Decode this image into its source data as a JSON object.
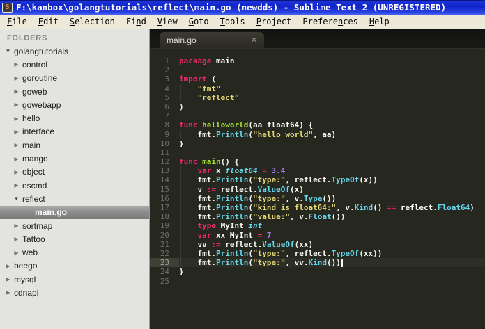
{
  "title_bar": {
    "title": "F:\\kanbox\\golangtutorials\\reflect\\main.go (newdds) - Sublime Text 2 (UNREGISTERED)",
    "icon_glyph": "S"
  },
  "menu": {
    "items": [
      {
        "label": "File",
        "accel": 0
      },
      {
        "label": "Edit",
        "accel": 0
      },
      {
        "label": "Selection",
        "accel": 0
      },
      {
        "label": "Find",
        "accel": 2
      },
      {
        "label": "View",
        "accel": 0
      },
      {
        "label": "Goto",
        "accel": 0
      },
      {
        "label": "Tools",
        "accel": 0
      },
      {
        "label": "Project",
        "accel": 0
      },
      {
        "label": "Preferences",
        "accel": 7
      },
      {
        "label": "Help",
        "accel": 0
      }
    ]
  },
  "sidebar": {
    "header": "FOLDERS",
    "items": [
      {
        "label": "golangtutorials",
        "indent": 0,
        "state": "open"
      },
      {
        "label": "control",
        "indent": 1,
        "state": "closed"
      },
      {
        "label": "goroutine",
        "indent": 1,
        "state": "closed"
      },
      {
        "label": "goweb",
        "indent": 1,
        "state": "closed"
      },
      {
        "label": "gowebapp",
        "indent": 1,
        "state": "closed"
      },
      {
        "label": "hello",
        "indent": 1,
        "state": "closed"
      },
      {
        "label": "interface",
        "indent": 1,
        "state": "closed"
      },
      {
        "label": "main",
        "indent": 1,
        "state": "closed"
      },
      {
        "label": "mango",
        "indent": 1,
        "state": "closed"
      },
      {
        "label": "object",
        "indent": 1,
        "state": "closed"
      },
      {
        "label": "oscmd",
        "indent": 1,
        "state": "closed"
      },
      {
        "label": "reflect",
        "indent": 1,
        "state": "open"
      },
      {
        "label": "main.go",
        "indent": 2,
        "state": "file",
        "selected": true
      },
      {
        "label": "sortmap",
        "indent": 1,
        "state": "closed"
      },
      {
        "label": "Tattoo",
        "indent": 1,
        "state": "closed"
      },
      {
        "label": "web",
        "indent": 1,
        "state": "closed"
      },
      {
        "label": "beego",
        "indent": 0,
        "state": "closed"
      },
      {
        "label": "mysql",
        "indent": 0,
        "state": "closed"
      },
      {
        "label": "cdnapi",
        "indent": 0,
        "state": "closed"
      }
    ]
  },
  "tab": {
    "label": "main.go",
    "close_glyph": "✕"
  },
  "editor": {
    "current_line": 23,
    "palette": {
      "kw": "#F92672",
      "str": "#E6DB74",
      "fn": "#A6E22E",
      "type": "#66D9EF",
      "call": "#66D9EF",
      "num": "#AE81FF",
      "fg": "#F8F8F2",
      "bg": "#26271F",
      "gutter": "#6E6F66",
      "sel_line": "#3E3F35"
    },
    "lines": [
      {
        "num": 1,
        "segs": [
          [
            "package",
            "k"
          ],
          [
            " main",
            "d"
          ]
        ]
      },
      {
        "num": 2,
        "segs": []
      },
      {
        "num": 3,
        "segs": [
          [
            "import",
            "k"
          ],
          [
            " (",
            "d"
          ]
        ]
      },
      {
        "num": 4,
        "g": true,
        "segs": [
          [
            "    ",
            "d"
          ],
          [
            "\"fmt\"",
            "s"
          ]
        ]
      },
      {
        "num": 5,
        "g": true,
        "segs": [
          [
            "    ",
            "d"
          ],
          [
            "\"reflect\"",
            "s"
          ]
        ]
      },
      {
        "num": 6,
        "segs": [
          [
            ")",
            "d"
          ]
        ]
      },
      {
        "num": 7,
        "segs": []
      },
      {
        "num": 8,
        "segs": [
          [
            "func",
            "k"
          ],
          [
            " ",
            "d"
          ],
          [
            "helloworld",
            "f"
          ],
          [
            "(aa float64) {",
            "d"
          ]
        ]
      },
      {
        "num": 9,
        "g": true,
        "segs": [
          [
            "    fmt.",
            "d"
          ],
          [
            "Println",
            "c"
          ],
          [
            "(",
            "d"
          ],
          [
            "\"hello world\"",
            "s"
          ],
          [
            ", aa)",
            "d"
          ]
        ]
      },
      {
        "num": 10,
        "segs": [
          [
            "}",
            "d"
          ]
        ]
      },
      {
        "num": 11,
        "segs": []
      },
      {
        "num": 12,
        "segs": [
          [
            "func",
            "k"
          ],
          [
            " ",
            "d"
          ],
          [
            "main",
            "f"
          ],
          [
            "() {",
            "d"
          ]
        ]
      },
      {
        "num": 13,
        "g": true,
        "segs": [
          [
            "    ",
            "d"
          ],
          [
            "var",
            "k"
          ],
          [
            " x ",
            "d"
          ],
          [
            "float64",
            "t"
          ],
          [
            " ",
            "d"
          ],
          [
            "=",
            "k"
          ],
          [
            " ",
            "d"
          ],
          [
            "3.4",
            "n"
          ]
        ]
      },
      {
        "num": 14,
        "g": true,
        "segs": [
          [
            "    fmt.",
            "d"
          ],
          [
            "Println",
            "c"
          ],
          [
            "(",
            "d"
          ],
          [
            "\"type:\"",
            "s"
          ],
          [
            ", reflect.",
            "d"
          ],
          [
            "TypeOf",
            "c"
          ],
          [
            "(x))",
            "d"
          ]
        ]
      },
      {
        "num": 15,
        "g": true,
        "segs": [
          [
            "    v ",
            "d"
          ],
          [
            ":=",
            "k"
          ],
          [
            " reflect.",
            "d"
          ],
          [
            "ValueOf",
            "c"
          ],
          [
            "(x)",
            "d"
          ]
        ]
      },
      {
        "num": 16,
        "g": true,
        "segs": [
          [
            "    fmt.",
            "d"
          ],
          [
            "Println",
            "c"
          ],
          [
            "(",
            "d"
          ],
          [
            "\"type:\"",
            "s"
          ],
          [
            ", v.",
            "d"
          ],
          [
            "Type",
            "c"
          ],
          [
            "())",
            "d"
          ]
        ]
      },
      {
        "num": 17,
        "g": true,
        "segs": [
          [
            "    fmt.",
            "d"
          ],
          [
            "Println",
            "c"
          ],
          [
            "(",
            "d"
          ],
          [
            "\"kind is float64:\"",
            "s"
          ],
          [
            ", v.",
            "d"
          ],
          [
            "Kind",
            "c"
          ],
          [
            "() ",
            "d"
          ],
          [
            "==",
            "k"
          ],
          [
            " reflect.",
            "d"
          ],
          [
            "Float64",
            "c"
          ],
          [
            ")",
            "d"
          ]
        ]
      },
      {
        "num": 18,
        "g": true,
        "segs": [
          [
            "    fmt.",
            "d"
          ],
          [
            "Println",
            "c"
          ],
          [
            "(",
            "d"
          ],
          [
            "\"value:\"",
            "s"
          ],
          [
            ", v.",
            "d"
          ],
          [
            "Float",
            "c"
          ],
          [
            "())",
            "d"
          ]
        ]
      },
      {
        "num": 19,
        "g": true,
        "segs": [
          [
            "    ",
            "d"
          ],
          [
            "type",
            "k"
          ],
          [
            " MyInt ",
            "d"
          ],
          [
            "int",
            "t"
          ]
        ]
      },
      {
        "num": 20,
        "g": true,
        "segs": [
          [
            "    ",
            "d"
          ],
          [
            "var",
            "k"
          ],
          [
            " xx MyInt ",
            "d"
          ],
          [
            "=",
            "k"
          ],
          [
            " ",
            "d"
          ],
          [
            "7",
            "n"
          ]
        ]
      },
      {
        "num": 21,
        "g": true,
        "segs": [
          [
            "    vv ",
            "d"
          ],
          [
            ":=",
            "k"
          ],
          [
            " reflect.",
            "d"
          ],
          [
            "ValueOf",
            "c"
          ],
          [
            "(xx)",
            "d"
          ]
        ]
      },
      {
        "num": 22,
        "g": true,
        "segs": [
          [
            "    fmt.",
            "d"
          ],
          [
            "Println",
            "c"
          ],
          [
            "(",
            "d"
          ],
          [
            "\"type:\"",
            "s"
          ],
          [
            ", reflect.",
            "d"
          ],
          [
            "TypeOf",
            "c"
          ],
          [
            "(xx))",
            "d"
          ]
        ]
      },
      {
        "num": 23,
        "g": true,
        "cursor": true,
        "segs": [
          [
            "    fmt.",
            "d"
          ],
          [
            "Println",
            "c"
          ],
          [
            "(",
            "d"
          ],
          [
            "\"type:\"",
            "s"
          ],
          [
            ", vv.",
            "d"
          ],
          [
            "Kind",
            "c"
          ],
          [
            "())",
            "d"
          ]
        ]
      },
      {
        "num": 24,
        "segs": [
          [
            "}",
            "d"
          ]
        ]
      },
      {
        "num": 25,
        "segs": []
      }
    ]
  }
}
